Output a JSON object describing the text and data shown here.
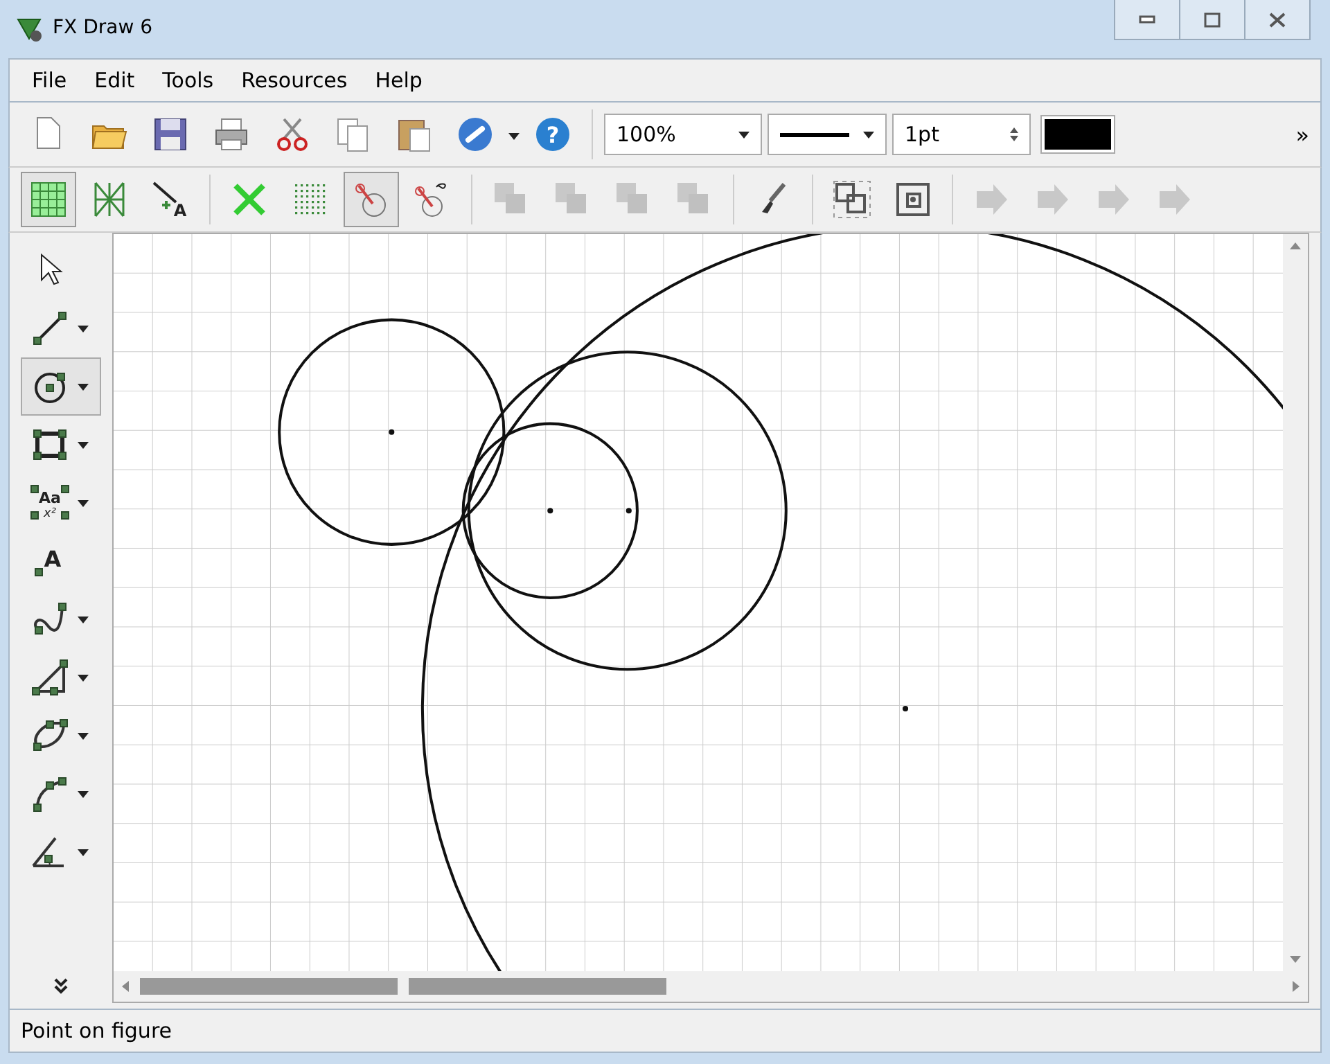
{
  "window": {
    "title": "FX Draw 6"
  },
  "menu": [
    "File",
    "Edit",
    "Tools",
    "Resources",
    "Help"
  ],
  "toolbar": [
    {
      "kind": "new",
      "disabled": false
    },
    {
      "kind": "open",
      "disabled": false
    },
    {
      "kind": "save",
      "disabled": false
    },
    {
      "kind": "print",
      "disabled": false
    },
    {
      "kind": "cut",
      "disabled": false
    },
    {
      "kind": "copy",
      "disabled": false
    },
    {
      "kind": "paste",
      "disabled": false
    },
    {
      "kind": "link",
      "disabled": false
    },
    {
      "kind": "help",
      "disabled": false,
      "glyph": "?"
    }
  ],
  "zoom": {
    "value": "100%"
  },
  "line_width": {
    "value": "1pt"
  },
  "overflow": "»",
  "toolbar2": [
    {
      "kind": "grid",
      "selected": true,
      "disabled": false
    },
    {
      "kind": "isogrid",
      "selected": false,
      "disabled": false
    },
    {
      "kind": "label",
      "selected": false,
      "disabled": false,
      "glyph": "A"
    },
    {
      "kind": "cross",
      "selected": false,
      "disabled": false
    },
    {
      "kind": "dots",
      "selected": false,
      "disabled": false
    },
    {
      "kind": "pin",
      "selected": true,
      "disabled": false
    },
    {
      "kind": "pininf",
      "selected": false,
      "disabled": false
    },
    {
      "kind": "layer",
      "selected": false,
      "disabled": true
    },
    {
      "kind": "layer",
      "selected": false,
      "disabled": true
    },
    {
      "kind": "layer",
      "selected": false,
      "disabled": true
    },
    {
      "kind": "layer",
      "selected": false,
      "disabled": true
    },
    {
      "kind": "brush",
      "selected": false,
      "disabled": false
    },
    {
      "kind": "group",
      "selected": false,
      "disabled": false
    },
    {
      "kind": "ungroup",
      "selected": false,
      "disabled": false
    },
    {
      "kind": "arrow",
      "selected": false,
      "disabled": true
    },
    {
      "kind": "arrow",
      "selected": false,
      "disabled": true
    },
    {
      "kind": "arrow",
      "selected": false,
      "disabled": true
    },
    {
      "kind": "arrow",
      "selected": false,
      "disabled": true
    }
  ],
  "tools": [
    {
      "kind": "pointer",
      "selected": false,
      "menu": false
    },
    {
      "kind": "line",
      "selected": false,
      "menu": true
    },
    {
      "kind": "circle",
      "selected": true,
      "menu": true
    },
    {
      "kind": "rect",
      "selected": false,
      "menu": true
    },
    {
      "kind": "textbox",
      "selected": false,
      "menu": true,
      "glyph": "Aa",
      "glyph2": "x²"
    },
    {
      "kind": "text",
      "selected": false,
      "menu": false,
      "glyph": "A"
    },
    {
      "kind": "curve",
      "selected": false,
      "menu": true
    },
    {
      "kind": "triangle",
      "selected": false,
      "menu": true
    },
    {
      "kind": "polygon",
      "selected": false,
      "menu": true
    },
    {
      "kind": "arc",
      "selected": false,
      "menu": true
    },
    {
      "kind": "angle",
      "selected": false,
      "menu": true
    }
  ],
  "status_bar": "Point on figure"
}
